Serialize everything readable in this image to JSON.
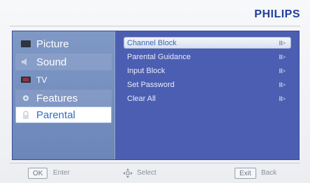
{
  "brand": "PHILIPS",
  "menu": {
    "items": [
      {
        "label": "Picture",
        "icon": "picture-icon"
      },
      {
        "label": "Sound",
        "icon": "speaker-icon"
      },
      {
        "label": "TV",
        "icon": "tv-icon"
      },
      {
        "label": "Features",
        "icon": "features-icon"
      },
      {
        "label": "Parental",
        "icon": "lock-icon",
        "selected": true
      }
    ]
  },
  "submenu": {
    "items": [
      {
        "label": "Channel Block",
        "selected": true
      },
      {
        "label": "Parental Guidance"
      },
      {
        "label": "Input Block"
      },
      {
        "label": "Set Password"
      },
      {
        "label": "Clear All"
      }
    ],
    "arrow": "III>"
  },
  "footer": {
    "ok_key": "OK",
    "ok_label": "Enter",
    "select_label": "Select",
    "exit_key": "Exit",
    "exit_label": "Back"
  },
  "colors": {
    "panel": "#4c5eb1",
    "menu": "#7a93c3",
    "selected_text": "#2f6ec7",
    "brand": "#1f3e9a"
  }
}
